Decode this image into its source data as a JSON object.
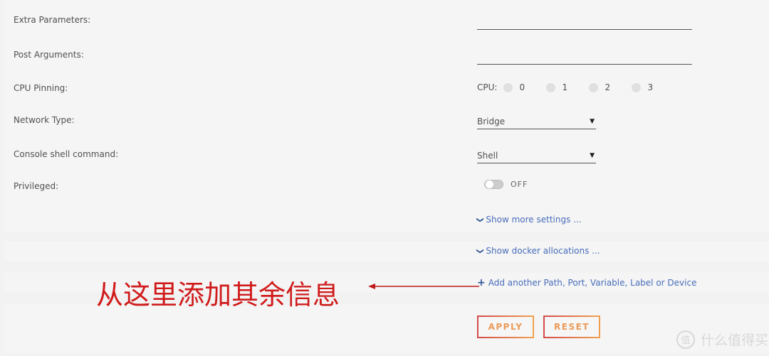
{
  "form": {
    "extra_parameters": {
      "label": "Extra Parameters:",
      "value": ""
    },
    "post_arguments": {
      "label": "Post Arguments:",
      "value": ""
    },
    "cpu_pinning": {
      "label": "CPU Pinning:",
      "prefix": "CPU:",
      "cores": [
        "0",
        "1",
        "2",
        "3"
      ]
    },
    "network_type": {
      "label": "Network Type:",
      "value": "Bridge",
      "caret": "▼"
    },
    "console_shell": {
      "label": "Console shell command:",
      "value": "Shell",
      "caret": "▼"
    },
    "privileged": {
      "label": "Privileged:",
      "state": "OFF"
    }
  },
  "links": {
    "show_more_settings": {
      "icon": "chevron-down",
      "glyph": "⌄",
      "text": "Show more settings ..."
    },
    "show_docker_allocations": {
      "icon": "chevron-down",
      "glyph": "⌄",
      "text": "Show docker allocations ..."
    },
    "add_another": {
      "icon": "plus",
      "glyph": "+",
      "text": "Add another Path, Port, Variable, Label or Device"
    }
  },
  "annotation": {
    "text": "从这里添加其余信息",
    "color": "#d01b1b"
  },
  "buttons": {
    "apply": "APPLY",
    "reset": "RESET"
  },
  "watermark": {
    "icon_glyph": "值",
    "text": "什么值得买"
  },
  "colors": {
    "link": "#486dba",
    "button_text": "#ec9a58",
    "button_border_start": "#d24b4b",
    "button_border_end": "#f0a050"
  }
}
